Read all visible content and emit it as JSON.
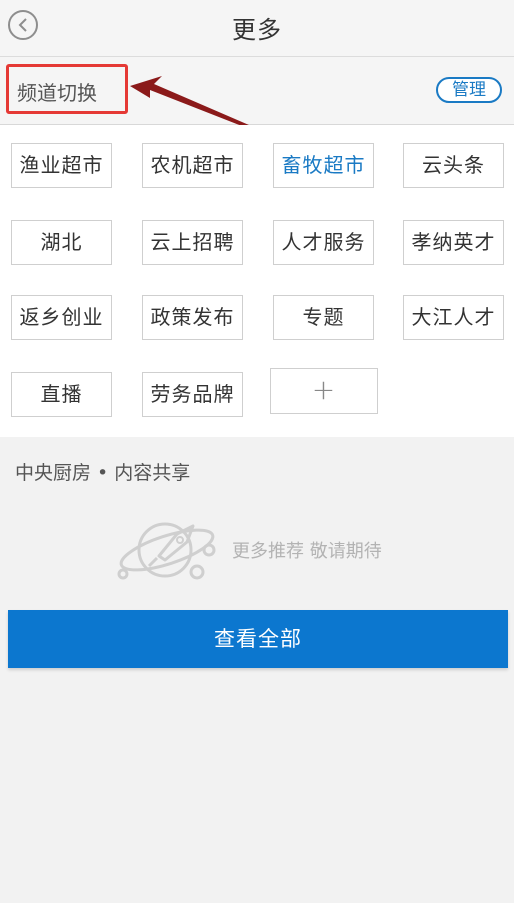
{
  "header": {
    "title": "更多",
    "back_icon": "chevron-left-icon"
  },
  "channel_section": {
    "label": "频道切换",
    "manage_label": "管理",
    "highlight_color": "#e53935",
    "arrow_color": "#8b1a1a"
  },
  "channels": [
    {
      "label": "渔业超市",
      "active": false
    },
    {
      "label": "农机超市",
      "active": false
    },
    {
      "label": "畜牧超市",
      "active": true
    },
    {
      "label": "云头条",
      "active": false
    },
    {
      "label": "湖北",
      "active": false
    },
    {
      "label": "云上招聘",
      "active": false
    },
    {
      "label": "人才服务",
      "active": false
    },
    {
      "label": "孝纳英才",
      "active": false
    },
    {
      "label": "返乡创业",
      "active": false
    },
    {
      "label": "政策发布",
      "active": false
    },
    {
      "label": "专题",
      "active": false
    },
    {
      "label": "大江人才",
      "active": false
    },
    {
      "label": "直播",
      "active": false
    },
    {
      "label": "劳务品牌",
      "active": false
    }
  ],
  "add_button": {
    "label": "+",
    "icon": "plus-icon"
  },
  "central": {
    "title": "中央厨房 • 内容共享",
    "empty_icon": "rocket-planet-icon",
    "empty_text": "更多推荐 敬请期待",
    "view_all_label": "查看全部"
  },
  "colors": {
    "accent": "#1a7ac4",
    "button_bg": "#0c77cf"
  }
}
